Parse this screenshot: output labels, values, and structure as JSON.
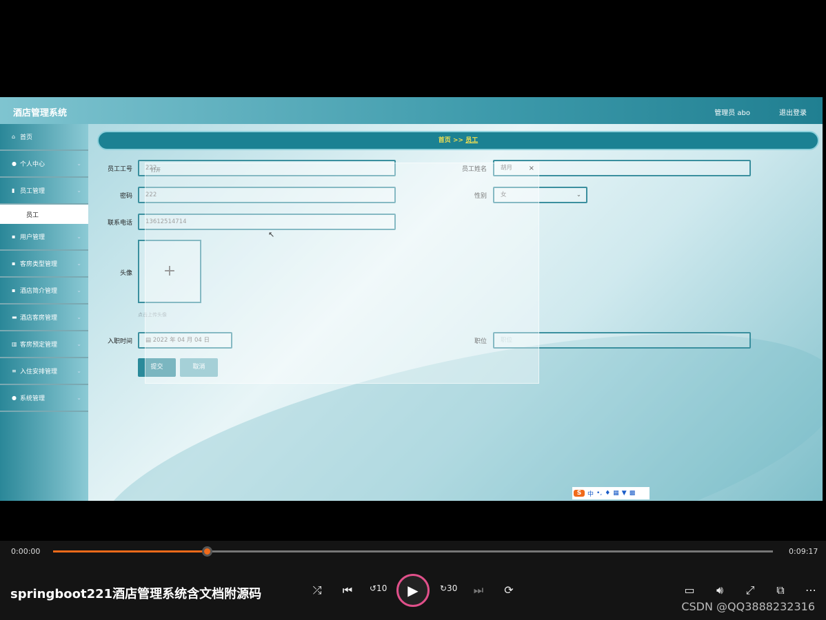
{
  "app": {
    "title": "酒店管理系统",
    "user": "管理员 abo",
    "logout": "退出登录"
  },
  "sidebar": {
    "items": [
      {
        "label": "首页",
        "icon": "home-icon",
        "chev": false
      },
      {
        "label": "个人中心",
        "icon": "user-icon",
        "chev": true
      },
      {
        "label": "员工管理",
        "icon": "book-icon",
        "chev": true,
        "sub": "员工"
      },
      {
        "label": "用户管理",
        "icon": "grid-icon",
        "chev": true
      },
      {
        "label": "客房类型管理",
        "icon": "grid-icon",
        "chev": true
      },
      {
        "label": "酒店简介管理",
        "icon": "grid-icon",
        "chev": true
      },
      {
        "label": "酒店客房管理",
        "icon": "comment-icon",
        "chev": true
      },
      {
        "label": "客房预定管理",
        "icon": "chart-icon",
        "chev": true
      },
      {
        "label": "入住安排管理",
        "icon": "sliders-icon",
        "chev": true
      },
      {
        "label": "系统管理",
        "icon": "user-icon",
        "chev": true
      }
    ]
  },
  "breadcrumb": {
    "home": "首页",
    "sep": ">>",
    "current": "员工"
  },
  "form": {
    "id_label": "员工工号",
    "id_value": "222",
    "autocomplete": "打开",
    "name_label": "员工姓名",
    "name_value": "胡月",
    "pwd_label": "密码",
    "pwd_value": "222",
    "gender_label": "性别",
    "gender_value": "女",
    "phone_label": "联系电话",
    "phone_value": "13612514714",
    "avatar_label": "头像",
    "avatar_hint": "点击上传头像",
    "date_label": "入职时间",
    "date_value": "2022 年 04 月 04 日",
    "position_label": "职位",
    "position_placeholder": "职位",
    "submit": "提交",
    "cancel": "取消"
  },
  "ime": {
    "lang": "中"
  },
  "player": {
    "current_time": "0:00:00",
    "total_time": "0:09:17",
    "progress_percent": 21.4,
    "video_title": "springboot221酒店管理系统含文档附源码",
    "watermark": "CSDN @QQ3888232316",
    "accent": "#f06a1a"
  }
}
